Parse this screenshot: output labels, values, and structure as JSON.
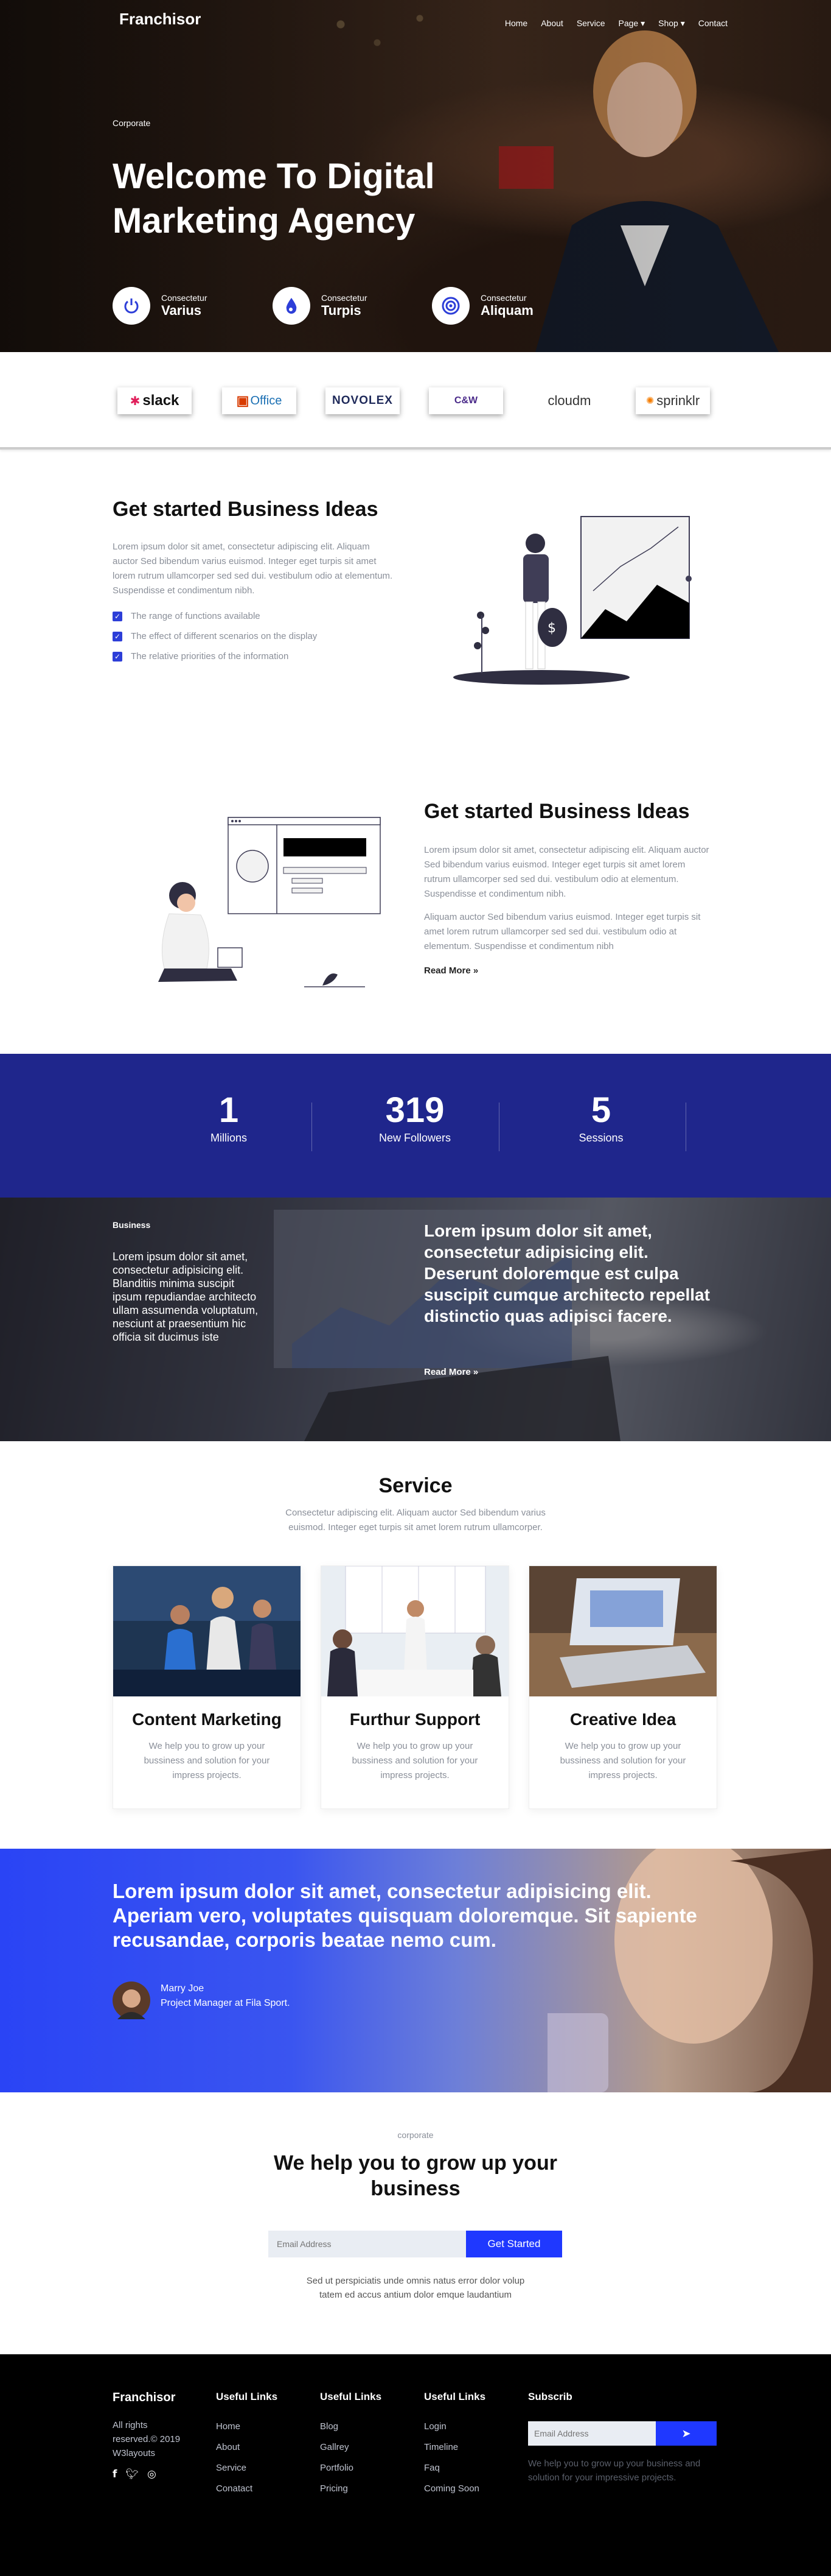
{
  "brand": "Franchisor",
  "nav": [
    "Home",
    "About",
    "Service",
    "Page ▾",
    "Shop ▾",
    "Contact"
  ],
  "hero": {
    "kicker": "Corporate",
    "title": "Welcome To Digital Marketing Agency",
    "features": [
      {
        "small": "Consectetur",
        "big": "Varius",
        "icon": "power-icon"
      },
      {
        "small": "Consectetur",
        "big": "Turpis",
        "icon": "drop-icon"
      },
      {
        "small": "Consectetur",
        "big": "Aliquam",
        "icon": "target-icon"
      }
    ]
  },
  "logos": [
    "slack",
    "Office",
    "NOVOLEX",
    "C&W",
    "cloudm",
    "sprinklr"
  ],
  "ideas1": {
    "title": "Get started Business Ideas",
    "text": "Lorem ipsum dolor sit amet, consectetur adipiscing elit. Aliquam auctor Sed bibendum varius euismod. Integer eget turpis sit amet lorem rutrum ullamcorper sed sed dui. vestibulum odio at elementum. Suspendisse et condimentum nibh.",
    "checks": [
      "The range of functions available",
      "The effect of different scenarios on the display",
      "The relative priorities of the information"
    ]
  },
  "ideas2": {
    "title": "Get started Business Ideas",
    "p1": "Lorem ipsum dolor sit amet, consectetur adipiscing elit. Aliquam auctor Sed bibendum varius euismod. Integer eget turpis sit amet lorem rutrum ullamcorper sed sed dui. vestibulum odio at elementum. Suspendisse et condimentum nibh.",
    "p2": "Aliquam auctor Sed bibendum varius euismod. Integer eget turpis sit amet lorem rutrum ullamcorper sed sed dui. vestibulum odio at elementum. Suspendisse et condimentum nibh",
    "more": "Read More »"
  },
  "stats": [
    {
      "n": "1",
      "l": "Millions"
    },
    {
      "n": "319",
      "l": "New Followers"
    },
    {
      "n": "5",
      "l": "Sessions"
    }
  ],
  "business": {
    "kicker": "Business",
    "left": "Lorem ipsum dolor sit amet, consectetur adipisicing elit. Blanditiis minima suscipit ipsum repudiandae architecto ullam assumenda voluptatum, nesciunt at praesentium hic officia sit ducimus iste",
    "right": "Lorem ipsum dolor sit amet, consectetur adipisicing elit. Deserunt doloremque est culpa suscipit cumque architecto repellat distinctio quas adipisci facere.",
    "more": "Read More »"
  },
  "service": {
    "title": "Service",
    "sub": "Consectetur adipiscing elit. Aliquam auctor Sed bibendum varius euismod. Integer eget turpis sit amet lorem rutrum ullamcorper.",
    "cards": [
      {
        "title": "Content Marketing",
        "text": "We help you to grow up your bussiness and solution for your impress projects."
      },
      {
        "title": "Furthur Support",
        "text": "We help you to grow up your bussiness and solution for your impress projects."
      },
      {
        "title": "Creative Idea",
        "text": "We help you to grow up your bussiness and solution for your impress projects."
      }
    ]
  },
  "testimonial": {
    "quote": "Lorem ipsum dolor sit amet, consectetur adipisicing elit. Aperiam vero, voluptates quisquam doloremque. Sit sapiente recusandae, corporis beatae nemo cum.",
    "name": "Marry Joe",
    "role": "Project Manager at Fila Sport."
  },
  "cta": {
    "kicker": "corporate",
    "title": "We help you to grow up your business",
    "placeholder": "Email Address",
    "button": "Get Started",
    "note": "Sed ut perspiciatis unde omnis natus error dolor volup tatem ed accus antium dolor emque laudantium"
  },
  "footer": {
    "brand": "Franchisor",
    "copy": "All rights reserved.© 2019 W3layouts",
    "cols": [
      {
        "h": "Useful Links",
        "links": [
          "Home",
          "About",
          "Service",
          "Conatact"
        ]
      },
      {
        "h": "Useful Links",
        "links": [
          "Blog",
          "Gallrey",
          "Portfolio",
          "Pricing"
        ]
      },
      {
        "h": "Useful Links",
        "links": [
          "Login",
          "Timeline",
          "Faq",
          "Coming Soon"
        ]
      }
    ],
    "sub": {
      "h": "Subscrib",
      "placeholder": "Email Address",
      "text": "We help you to grow up your business and solution for your impressive projects."
    }
  },
  "colors": {
    "accent": "#2d3ed8",
    "stats_bg": "#1f268c"
  }
}
